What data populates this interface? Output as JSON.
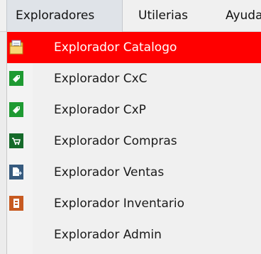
{
  "menubar": {
    "items": [
      {
        "label": "Exploradores"
      },
      {
        "label": "Utilerias"
      },
      {
        "label": "Ayuda"
      }
    ]
  },
  "dropdown": {
    "items": [
      {
        "label": "Explorador Catalogo",
        "icon": "folder-document-icon",
        "selected": true
      },
      {
        "label": "Explorador CxC",
        "icon": "tag-icon"
      },
      {
        "label": "Explorador CxP",
        "icon": "tag-icon"
      },
      {
        "label": "Explorador Compras",
        "icon": "cart-icon"
      },
      {
        "label": "Explorador Ventas",
        "icon": "sales-document-icon"
      },
      {
        "label": "Explorador Inventario",
        "icon": "inventory-icon"
      },
      {
        "label": "Explorador Admin",
        "icon": ""
      }
    ]
  },
  "colors": {
    "selection": "#ff0000",
    "menubar_bg": "#f0f0f0",
    "tag_green": "#1e9a32",
    "cart_green": "#156a2a",
    "sales_blue": "#365a7e",
    "inventory_orange": "#c75a21"
  }
}
